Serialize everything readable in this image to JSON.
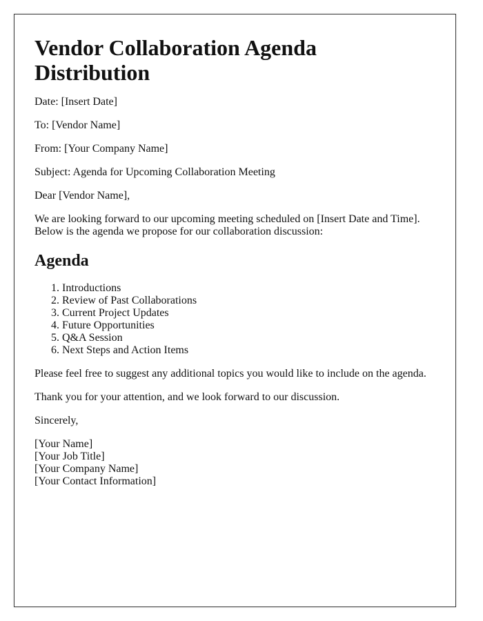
{
  "document": {
    "title": "Vendor Collaboration Agenda Distribution",
    "header_fields": {
      "date": "Date: [Insert Date]",
      "to": "To: [Vendor Name]",
      "from": "From: [Your Company Name]",
      "subject": "Subject: Agenda for Upcoming Collaboration Meeting"
    },
    "salutation": "Dear [Vendor Name],",
    "intro": "We are looking forward to our upcoming meeting scheduled on [Insert Date and Time]. Below is the agenda we propose for our collaboration discussion:",
    "agenda_heading": "Agenda",
    "agenda_items": [
      "Introductions",
      "Review of Past Collaborations",
      "Current Project Updates",
      "Future Opportunities",
      "Q&A Session",
      "Next Steps and Action Items"
    ],
    "closing_paragraphs": [
      "Please feel free to suggest any additional topics you would like to include on the agenda.",
      "Thank you for your attention, and we look forward to our discussion."
    ],
    "sign_off": "Sincerely,",
    "signature": [
      "[Your Name]",
      "[Your Job Title]",
      "[Your Company Name]",
      "[Your Contact Information]"
    ]
  }
}
